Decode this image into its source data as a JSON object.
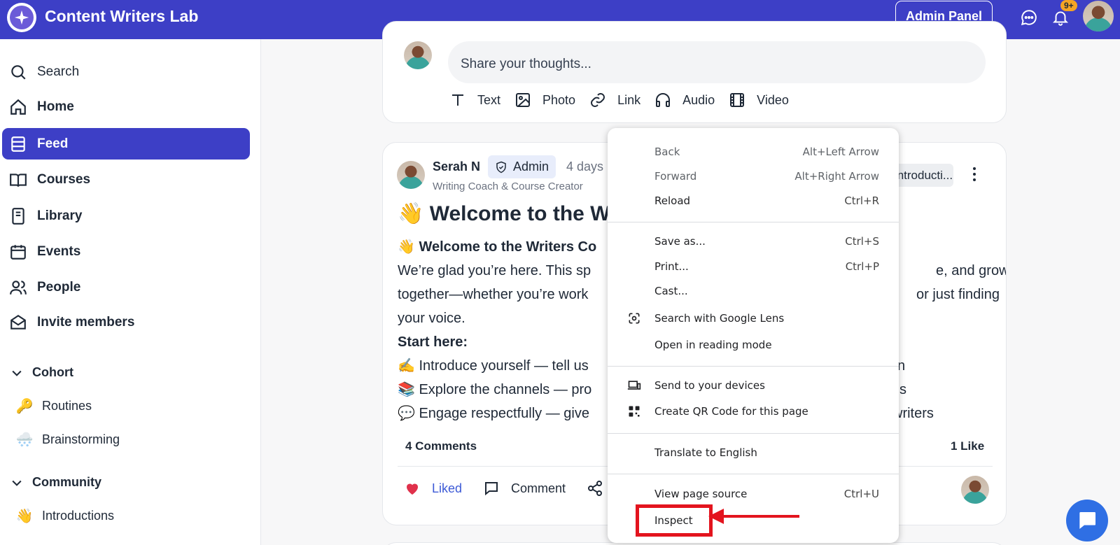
{
  "header": {
    "app_title": "Content Writers Lab",
    "admin_panel_label": "Admin Panel",
    "notification_badge": "9+",
    "brand_color": "#3d3fc6"
  },
  "sidebar": {
    "search_label": "Search",
    "items": [
      {
        "label": "Home",
        "icon": "home-icon"
      },
      {
        "label": "Feed",
        "icon": "feed-icon",
        "active": true
      },
      {
        "label": "Courses",
        "icon": "book-open-icon"
      },
      {
        "label": "Library",
        "icon": "library-icon"
      },
      {
        "label": "Events",
        "icon": "calendar-icon"
      },
      {
        "label": "People",
        "icon": "people-icon"
      },
      {
        "label": "Invite members",
        "icon": "envelope-icon"
      }
    ],
    "sections": [
      {
        "title": "Cohort",
        "channels": [
          {
            "emoji": "🔑",
            "label": "Routines"
          },
          {
            "emoji": "🌨️",
            "label": "Brainstorming"
          }
        ]
      },
      {
        "title": "Community",
        "channels": [
          {
            "emoji": "👋",
            "label": "Introductions"
          }
        ]
      }
    ]
  },
  "composer": {
    "placeholder": "Share your thoughts...",
    "tools": [
      "Text",
      "Photo",
      "Link",
      "Audio",
      "Video"
    ]
  },
  "post": {
    "author": "Serah N",
    "badge": "Admin",
    "time": "4 days",
    "subtitle": "Writing Coach & Course Creator",
    "channel_chip": "Introducti...",
    "title": "👋 Welcome to the W",
    "body": {
      "bold_intro": "Welcome to the Writers Co",
      "line1": "We’re glad you’re here. This sp",
      "line1_end": "e, and grow",
      "line2": "together—whether you’re work",
      "line2_end": "or just finding",
      "line3": "your voice.",
      "start_here": "Start here:",
      "bullet1": "Introduce yourself — tell us",
      "bullet1_end": "n",
      "bullet2": "Explore the channels — pro",
      "bullet2_end": "s",
      "bullet3": "Engage respectfully — give",
      "bullet3_end": "writers"
    },
    "comments_count": "4 Comments",
    "likes_count": "1 Like",
    "actions": {
      "liked": "Liked",
      "comment": "Comment"
    }
  },
  "context_menu": {
    "groups": [
      [
        {
          "label": "Back",
          "shortcut": "Alt+Left Arrow",
          "disabled": true
        },
        {
          "label": "Forward",
          "shortcut": "Alt+Right Arrow",
          "disabled": true
        },
        {
          "label": "Reload",
          "shortcut": "Ctrl+R"
        }
      ],
      [
        {
          "label": "Save as...",
          "shortcut": "Ctrl+S"
        },
        {
          "label": "Print...",
          "shortcut": "Ctrl+P"
        },
        {
          "label": "Cast..."
        },
        {
          "label": "Search with Google Lens",
          "icon": "google-lens-icon"
        },
        {
          "label": "Open in reading mode"
        }
      ],
      [
        {
          "label": "Send to your devices",
          "icon": "devices-icon"
        },
        {
          "label": "Create QR Code for this page",
          "icon": "qr-code-icon"
        }
      ],
      [
        {
          "label": "Translate to English"
        }
      ],
      [
        {
          "label": "View page source",
          "shortcut": "Ctrl+U"
        },
        {
          "label": "Inspect",
          "highlighted": true
        }
      ]
    ],
    "highlight_color": "#e3141e"
  }
}
